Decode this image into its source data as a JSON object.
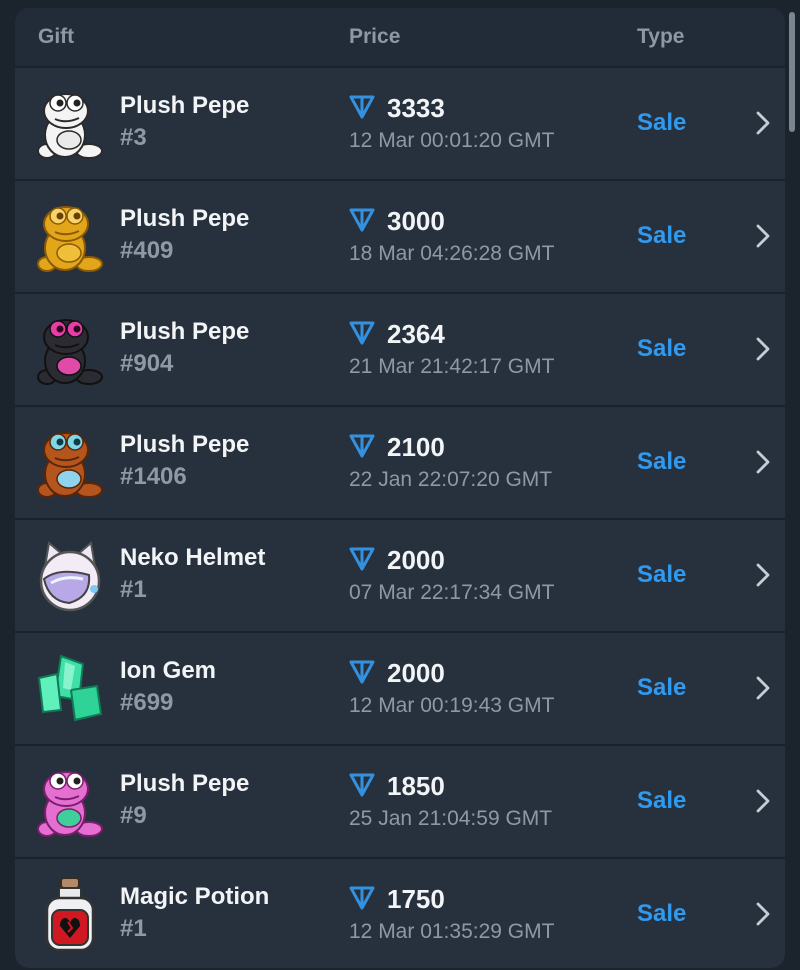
{
  "header": {
    "gift": "Gift",
    "price": "Price",
    "type": "Type"
  },
  "colors": {
    "accent": "#2f9af0",
    "ton": "#3391e0",
    "text": "#f2f4f6",
    "muted": "#8e99a5"
  },
  "rows": [
    {
      "name": "Plush Pepe",
      "number": "#3",
      "price": "3333",
      "time": "12 Mar 00:01:20 GMT",
      "type": "Sale",
      "icon": "plush-pepe-white-icon"
    },
    {
      "name": "Plush Pepe",
      "number": "#409",
      "price": "3000",
      "time": "18 Mar 04:26:28 GMT",
      "type": "Sale",
      "icon": "plush-pepe-gold-icon"
    },
    {
      "name": "Plush Pepe",
      "number": "#904",
      "price": "2364",
      "time": "21 Mar 21:42:17 GMT",
      "type": "Sale",
      "icon": "plush-pepe-black-pink-icon"
    },
    {
      "name": "Plush Pepe",
      "number": "#1406",
      "price": "2100",
      "time": "22 Jan 22:07:20 GMT",
      "type": "Sale",
      "icon": "plush-pepe-bronze-icon"
    },
    {
      "name": "Neko Helmet",
      "number": "#1",
      "price": "2000",
      "time": "07 Mar 22:17:34 GMT",
      "type": "Sale",
      "icon": "neko-helmet-icon"
    },
    {
      "name": "Ion Gem",
      "number": "#699",
      "price": "2000",
      "time": "12 Mar 00:19:43 GMT",
      "type": "Sale",
      "icon": "ion-gem-icon"
    },
    {
      "name": "Plush Pepe",
      "number": "#9",
      "price": "1850",
      "time": "25 Jan 21:04:59 GMT",
      "type": "Sale",
      "icon": "plush-pepe-pink-icon"
    },
    {
      "name": "Magic Potion",
      "number": "#1",
      "price": "1750",
      "time": "12 Mar 01:35:29 GMT",
      "type": "Sale",
      "icon": "magic-potion-icon"
    }
  ]
}
